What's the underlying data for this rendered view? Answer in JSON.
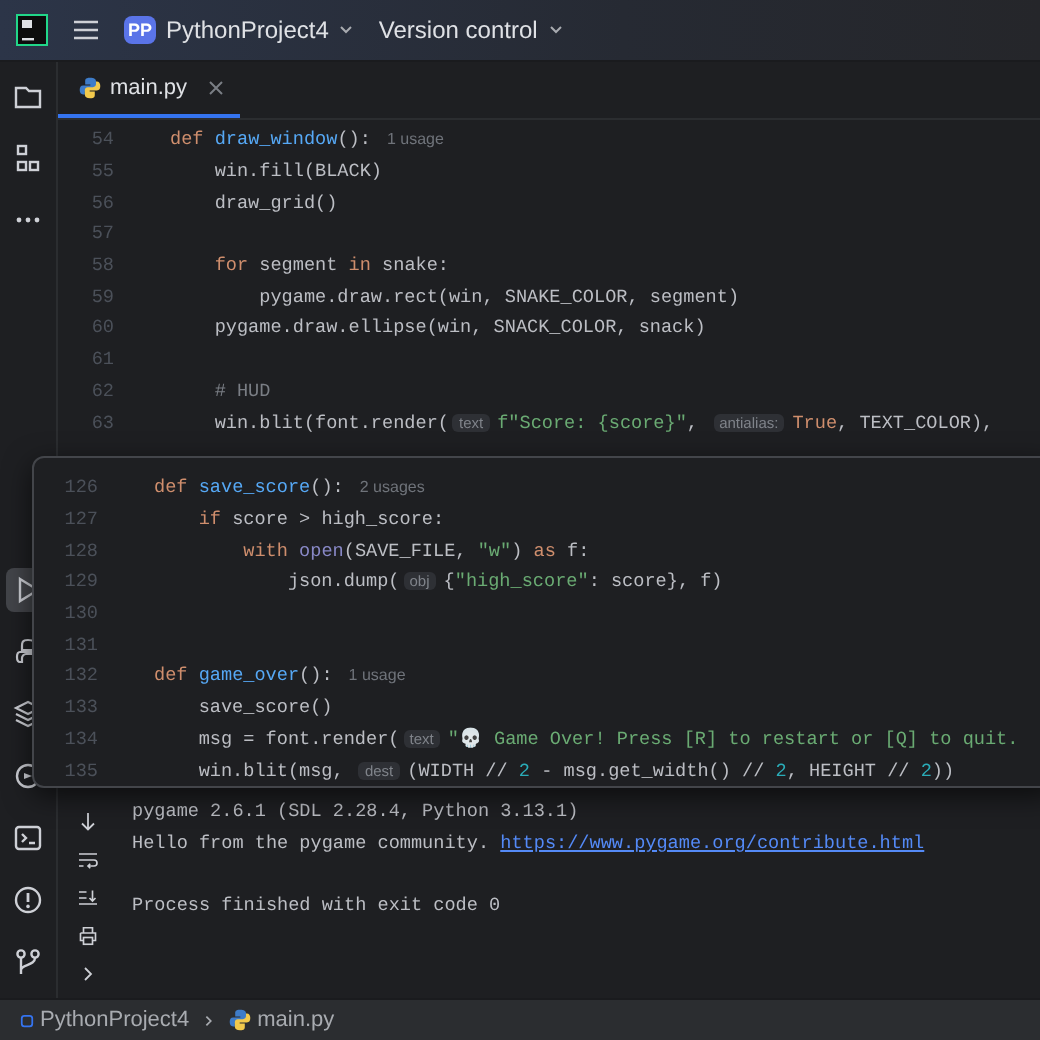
{
  "header": {
    "project_badge": "PP",
    "project_name": "PythonProject4",
    "vcs_menu": "Version control"
  },
  "tabs": [
    {
      "label": "main.py",
      "selected": true
    }
  ],
  "tool_strip": {
    "top": [
      {
        "kind": "folder",
        "selected": false
      },
      {
        "kind": "structure",
        "selected": false
      },
      {
        "kind": "more",
        "selected": false
      }
    ],
    "bottom": [
      {
        "kind": "run",
        "selected": true
      },
      {
        "kind": "console",
        "selected": false
      },
      {
        "kind": "layers",
        "selected": false
      },
      {
        "kind": "services",
        "selected": false
      },
      {
        "kind": "terminal",
        "selected": false
      },
      {
        "kind": "problems",
        "selected": false
      },
      {
        "kind": "git",
        "selected": false
      }
    ]
  },
  "editor": {
    "lines": [
      {
        "number": "54",
        "tokens": [
          {
            "kind": "kw",
            "text": "def "
          },
          {
            "kind": "fn",
            "text": "draw_window"
          },
          {
            "kind": "plain",
            "text": "():"
          },
          {
            "kind": "usage",
            "text": "1 usage"
          }
        ]
      },
      {
        "number": "55",
        "tokens": [
          {
            "kind": "plain",
            "text": "    win.fill(BLACK)"
          }
        ]
      },
      {
        "number": "56",
        "tokens": [
          {
            "kind": "plain",
            "text": "    draw_grid()"
          }
        ]
      },
      {
        "number": "57"
      },
      {
        "number": "58",
        "tokens": [
          {
            "kind": "kw",
            "text": "    for"
          },
          {
            "kind": "plain",
            "text": " segment "
          },
          {
            "kind": "kw",
            "text": "in"
          },
          {
            "kind": "plain",
            "text": " snake:"
          }
        ]
      },
      {
        "number": "59",
        "tokens": [
          {
            "kind": "plain",
            "text": "        pygame.draw.rect(win, SNAKE_COLOR, segment)"
          }
        ]
      },
      {
        "number": "60",
        "tokens": [
          {
            "kind": "plain",
            "text": "    pygame.draw.ellipse(win, SNACK_COLOR, snack)"
          }
        ]
      },
      {
        "number": "61"
      },
      {
        "number": "62",
        "tokens": [
          {
            "kind": "comment",
            "text": "    # HUD"
          }
        ]
      },
      {
        "number": "63",
        "tokens": [
          {
            "kind": "plain",
            "text": "    win.blit(font.render("
          },
          {
            "kind": "hint",
            "text": "text"
          },
          {
            "kind": "str",
            "text": "f\"Score: {score}\""
          },
          {
            "kind": "plain",
            "text": ", "
          },
          {
            "kind": "hint",
            "text": "antialias:"
          },
          {
            "kind": "kw",
            "text": "True"
          },
          {
            "kind": "plain",
            "text": ", TEXT_COLOR),"
          }
        ]
      }
    ]
  },
  "popup": {
    "lines": [
      {
        "number": "126",
        "tokens": [
          {
            "kind": "kw",
            "text": "def "
          },
          {
            "kind": "fn",
            "text": "save_score"
          },
          {
            "kind": "plain",
            "text": "():"
          },
          {
            "kind": "usage",
            "text": "2 usages"
          }
        ]
      },
      {
        "number": "127",
        "tokens": [
          {
            "kind": "kw",
            "text": "    if"
          },
          {
            "kind": "plain",
            "text": " score > high_score:"
          }
        ]
      },
      {
        "number": "128",
        "tokens": [
          {
            "kind": "kw",
            "text": "        with"
          },
          {
            "kind": "builtin",
            "text": " open"
          },
          {
            "kind": "plain",
            "text": "(SAVE_FILE, "
          },
          {
            "kind": "str",
            "text": "\"w\""
          },
          {
            "kind": "plain",
            "text": ") "
          },
          {
            "kind": "kw",
            "text": "as"
          },
          {
            "kind": "plain",
            "text": " f:"
          }
        ]
      },
      {
        "number": "129",
        "tokens": [
          {
            "kind": "plain",
            "text": "            json.dump("
          },
          {
            "kind": "hint",
            "text": "obj"
          },
          {
            "kind": "plain",
            "text": "{"
          },
          {
            "kind": "str",
            "text": "\"high_score\""
          },
          {
            "kind": "plain",
            "text": ": score}, f)"
          }
        ]
      },
      {
        "number": "130"
      },
      {
        "number": "131"
      },
      {
        "number": "132",
        "tokens": [
          {
            "kind": "kw",
            "text": "def "
          },
          {
            "kind": "fn",
            "text": "game_over"
          },
          {
            "kind": "plain",
            "text": "():"
          },
          {
            "kind": "usage",
            "text": "1 usage"
          }
        ]
      },
      {
        "number": "133",
        "tokens": [
          {
            "kind": "plain",
            "text": "    save_score()"
          }
        ]
      },
      {
        "number": "134",
        "tokens": [
          {
            "kind": "plain",
            "text": "    msg = font.render("
          },
          {
            "kind": "hint",
            "text": "text"
          },
          {
            "kind": "str",
            "text": "\"💀 Game Over! Press [R] to restart or [Q] to quit."
          }
        ]
      },
      {
        "number": "135",
        "tokens": [
          {
            "kind": "plain",
            "text": "    win.blit(msg, "
          },
          {
            "kind": "hint",
            "text": "dest"
          },
          {
            "kind": "plain",
            "text": "(WIDTH // "
          },
          {
            "kind": "num",
            "text": "2"
          },
          {
            "kind": "plain",
            "text": " - msg.get_width() // "
          },
          {
            "kind": "num",
            "text": "2"
          },
          {
            "kind": "plain",
            "text": ", HEIGHT // "
          },
          {
            "kind": "num",
            "text": "2"
          },
          {
            "kind": "plain",
            "text": "))"
          }
        ]
      }
    ]
  },
  "run_panel": {
    "tools": [
      {
        "kind": "down"
      },
      {
        "kind": "wrap"
      },
      {
        "kind": "scroll-end"
      },
      {
        "kind": "print"
      },
      {
        "kind": "expand"
      }
    ],
    "output": [
      {
        "text": "pygame 2.6.1 (SDL 2.28.4, Python 3.13.1)"
      },
      {
        "text": "Hello from the pygame community.",
        "link": "https://www.pygame.org/contribute.html"
      }
    ],
    "exit_message": "Process finished with exit code 0"
  },
  "status_bar": {
    "breadcrumbs": [
      {
        "kind": "module",
        "label": "PythonProject4"
      },
      {
        "kind": "python-file",
        "label": "main.py"
      }
    ]
  }
}
